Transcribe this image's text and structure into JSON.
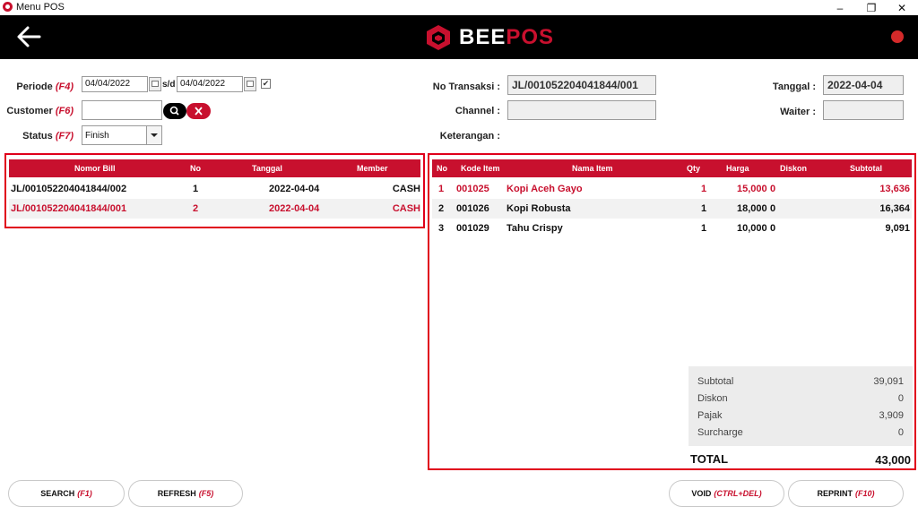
{
  "window": {
    "title": "Menu POS",
    "minimize": "–",
    "restore": "❐",
    "close": "✕"
  },
  "brand": {
    "name": "BEEPOS",
    "name_main": "BEE",
    "name_accent": "POS",
    "accent_color": "#c8102e"
  },
  "filters": {
    "periode_label": "Periode",
    "periode_key": "(F4)",
    "date_from": "04/04/2022",
    "sd": "s/d",
    "date_to": "04/04/2022",
    "customer_label": "Customer",
    "customer_key": "(F6)",
    "customer_value": "",
    "status_label": "Status",
    "status_key": "(F7)",
    "status_value": "Finish"
  },
  "info": {
    "no_transaksi_label": "No Transaksi :",
    "no_transaksi": "JL/001052204041844/001",
    "channel_label": "Channel :",
    "channel": "",
    "keterangan_label": "Keterangan :",
    "tanggal_label": "Tanggal :",
    "tanggal": "2022-04-04",
    "waiter_label": "Waiter :",
    "waiter": ""
  },
  "bills": {
    "headers": {
      "nomor_bill": "Nomor Bill",
      "no": "No",
      "tanggal": "Tanggal",
      "member": "Member"
    },
    "rows": [
      {
        "nomor_bill": "JL/001052204041844/002",
        "no": "1",
        "tanggal": "2022-04-04",
        "member": "CASH"
      },
      {
        "nomor_bill": "JL/001052204041844/001",
        "no": "2",
        "tanggal": "2022-04-04",
        "member": "CASH"
      }
    ]
  },
  "items": {
    "headers": {
      "no": "No",
      "kode": "Kode Item",
      "nama": "Nama Item",
      "qty": "Qty",
      "harga": "Harga",
      "diskon": "Diskon",
      "subtotal": "Subtotal"
    },
    "rows": [
      {
        "no": "1",
        "kode": "001025",
        "nama": "Kopi Aceh Gayo",
        "qty": "1",
        "harga": "15,000",
        "diskon": "0",
        "subtotal": "13,636"
      },
      {
        "no": "2",
        "kode": "001026",
        "nama": "Kopi Robusta",
        "qty": "1",
        "harga": "18,000",
        "diskon": "0",
        "subtotal": "16,364"
      },
      {
        "no": "3",
        "kode": "001029",
        "nama": "Tahu Crispy",
        "qty": "1",
        "harga": "10,000",
        "diskon": "0",
        "subtotal": "9,091"
      }
    ]
  },
  "summary": {
    "subtotal_label": "Subtotal",
    "subtotal": "39,091",
    "diskon_label": "Diskon",
    "diskon": "0",
    "pajak_label": "Pajak",
    "pajak": "3,909",
    "surcharge_label": "Surcharge",
    "surcharge": "0",
    "total_label": "TOTAL",
    "total": "43,000"
  },
  "buttons": {
    "search": "SEARCH",
    "search_key": "(F1)",
    "refresh": "REFRESH",
    "refresh_key": "(F5)",
    "void": "VOID",
    "void_key": "(CTRL+DEL)",
    "reprint": "REPRINT",
    "reprint_key": "(F10)"
  }
}
